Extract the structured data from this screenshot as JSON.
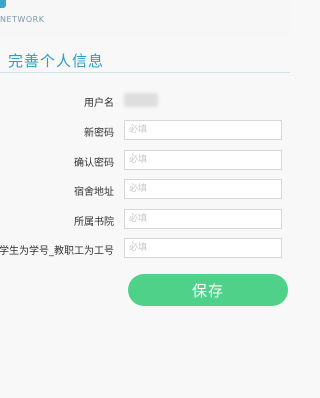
{
  "brand": {
    "text": "NETWORK"
  },
  "section": {
    "title": "完善个人信息"
  },
  "form": {
    "username_label": "用户名",
    "new_password": {
      "label": "新密码",
      "placeholder": "必填"
    },
    "confirm_password": {
      "label": "确认密码",
      "placeholder": "必填"
    },
    "dorm_address": {
      "label": "宿舍地址",
      "placeholder": "必填"
    },
    "college": {
      "label": "所属书院",
      "placeholder": "必填"
    },
    "id_number": {
      "label": "学生为学号_教职工为工号",
      "placeholder": "必填"
    }
  },
  "actions": {
    "save_label": "保存"
  },
  "colors": {
    "accent": "#2a9ec3",
    "button": "#4fd18a"
  }
}
